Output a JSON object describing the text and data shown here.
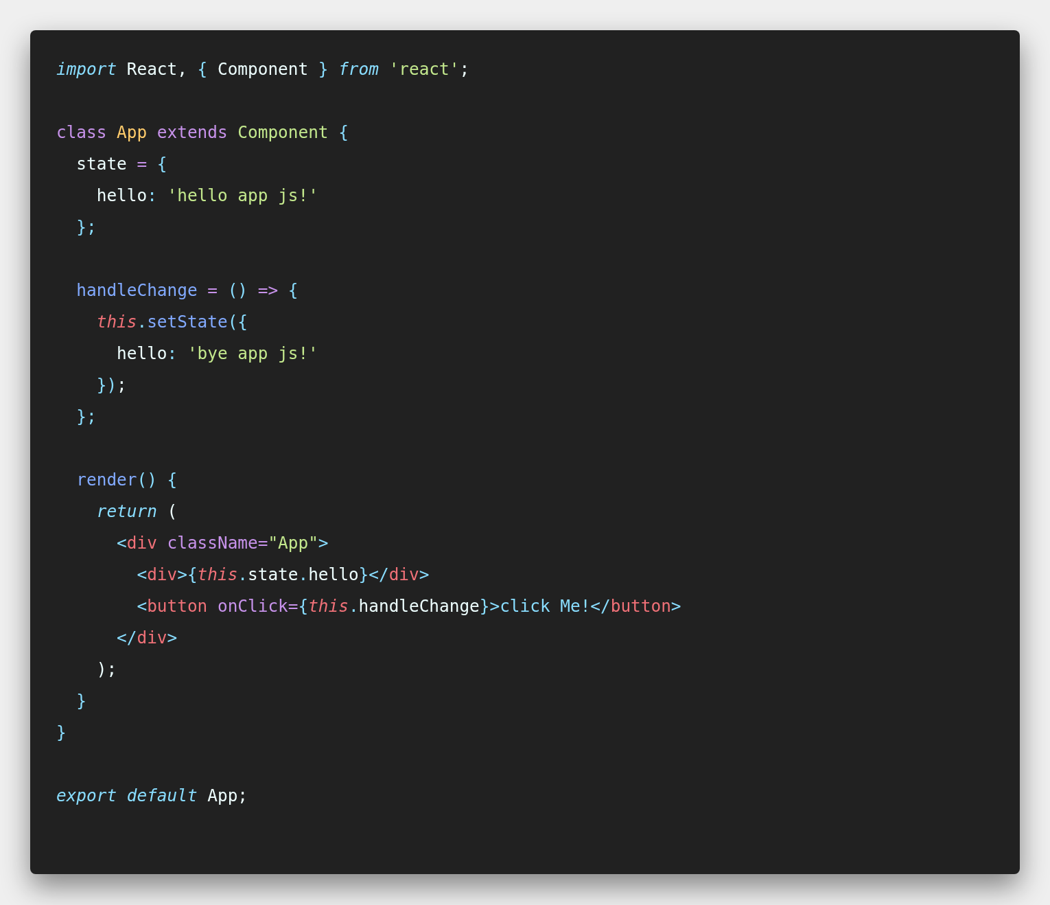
{
  "code": {
    "lines": [
      {
        "kind": "code",
        "tokens": [
          {
            "kind": "keyword",
            "text": "import "
          },
          {
            "kind": "plain",
            "text": "React, "
          },
          {
            "kind": "punct",
            "text": "{"
          },
          {
            "kind": "plain",
            "text": " Component "
          },
          {
            "kind": "punct",
            "text": "} "
          },
          {
            "kind": "keyword",
            "text": "from "
          },
          {
            "kind": "string",
            "text": "'react'"
          },
          {
            "kind": "plain",
            "text": ";"
          }
        ]
      },
      {
        "kind": "blank"
      },
      {
        "kind": "code",
        "tokens": [
          {
            "kind": "storage",
            "text": "class "
          },
          {
            "kind": "classname",
            "text": "App "
          },
          {
            "kind": "storage",
            "text": "extends "
          },
          {
            "kind": "string",
            "text": "Component "
          },
          {
            "kind": "punct",
            "text": "{"
          }
        ]
      },
      {
        "kind": "code",
        "tokens": [
          {
            "kind": "plain",
            "text": "  state "
          },
          {
            "kind": "storage",
            "text": "= "
          },
          {
            "kind": "punct",
            "text": "{"
          }
        ]
      },
      {
        "kind": "code",
        "tokens": [
          {
            "kind": "plain",
            "text": "    hello"
          },
          {
            "kind": "punct",
            "text": ": "
          },
          {
            "kind": "string",
            "text": "'hello app js!'"
          }
        ]
      },
      {
        "kind": "code",
        "tokens": [
          {
            "kind": "punct",
            "text": "  };"
          }
        ]
      },
      {
        "kind": "blank"
      },
      {
        "kind": "code",
        "tokens": [
          {
            "kind": "func",
            "text": "  handleChange "
          },
          {
            "kind": "storage",
            "text": "= "
          },
          {
            "kind": "punct",
            "text": "() "
          },
          {
            "kind": "storage",
            "text": "=> "
          },
          {
            "kind": "punct",
            "text": "{"
          }
        ]
      },
      {
        "kind": "code",
        "tokens": [
          {
            "kind": "this",
            "text": "    this"
          },
          {
            "kind": "punct",
            "text": "."
          },
          {
            "kind": "func",
            "text": "setState"
          },
          {
            "kind": "punct",
            "text": "({"
          }
        ]
      },
      {
        "kind": "code",
        "tokens": [
          {
            "kind": "plain",
            "text": "      hello"
          },
          {
            "kind": "punct",
            "text": ": "
          },
          {
            "kind": "string",
            "text": "'bye app js!'"
          }
        ]
      },
      {
        "kind": "code",
        "tokens": [
          {
            "kind": "punct",
            "text": "    })"
          },
          {
            "kind": "plain",
            "text": ";"
          }
        ]
      },
      {
        "kind": "code",
        "tokens": [
          {
            "kind": "punct",
            "text": "  };"
          }
        ]
      },
      {
        "kind": "blank"
      },
      {
        "kind": "code",
        "tokens": [
          {
            "kind": "func",
            "text": "  render"
          },
          {
            "kind": "punct",
            "text": "() {"
          }
        ]
      },
      {
        "kind": "code",
        "tokens": [
          {
            "kind": "keyword",
            "text": "    return "
          },
          {
            "kind": "plain",
            "text": "("
          }
        ]
      },
      {
        "kind": "code",
        "tokens": [
          {
            "kind": "punct",
            "text": "      <"
          },
          {
            "kind": "tag",
            "text": "div"
          },
          {
            "kind": "storage",
            "text": " className="
          },
          {
            "kind": "string",
            "text": "\"App\""
          },
          {
            "kind": "punct",
            "text": ">"
          }
        ]
      },
      {
        "kind": "code",
        "tokens": [
          {
            "kind": "punct",
            "text": "        <"
          },
          {
            "kind": "tag",
            "text": "div"
          },
          {
            "kind": "punct",
            "text": ">{"
          },
          {
            "kind": "this",
            "text": "this"
          },
          {
            "kind": "punct",
            "text": "."
          },
          {
            "kind": "plain",
            "text": "state"
          },
          {
            "kind": "punct",
            "text": "."
          },
          {
            "kind": "plain",
            "text": "hello"
          },
          {
            "kind": "punct",
            "text": "}</"
          },
          {
            "kind": "tag",
            "text": "div"
          },
          {
            "kind": "punct",
            "text": ">"
          }
        ]
      },
      {
        "kind": "code",
        "tokens": [
          {
            "kind": "punct",
            "text": "        <"
          },
          {
            "kind": "tag",
            "text": "button"
          },
          {
            "kind": "storage",
            "text": " onClick="
          },
          {
            "kind": "punct",
            "text": "{"
          },
          {
            "kind": "this",
            "text": "this"
          },
          {
            "kind": "punct",
            "text": "."
          },
          {
            "kind": "plain",
            "text": "handleChange"
          },
          {
            "kind": "punct",
            "text": "}>click Me!</"
          },
          {
            "kind": "tag",
            "text": "button"
          },
          {
            "kind": "punct",
            "text": ">"
          }
        ]
      },
      {
        "kind": "code",
        "tokens": [
          {
            "kind": "punct",
            "text": "      </"
          },
          {
            "kind": "tag",
            "text": "div"
          },
          {
            "kind": "punct",
            "text": ">"
          }
        ]
      },
      {
        "kind": "code",
        "tokens": [
          {
            "kind": "plain",
            "text": "    );"
          }
        ]
      },
      {
        "kind": "code",
        "tokens": [
          {
            "kind": "punct",
            "text": "  }"
          }
        ]
      },
      {
        "kind": "code",
        "tokens": [
          {
            "kind": "punct",
            "text": "}"
          }
        ]
      },
      {
        "kind": "blank"
      },
      {
        "kind": "code",
        "tokens": [
          {
            "kind": "keyword",
            "text": "export default "
          },
          {
            "kind": "plain",
            "text": "App;"
          }
        ]
      }
    ]
  }
}
